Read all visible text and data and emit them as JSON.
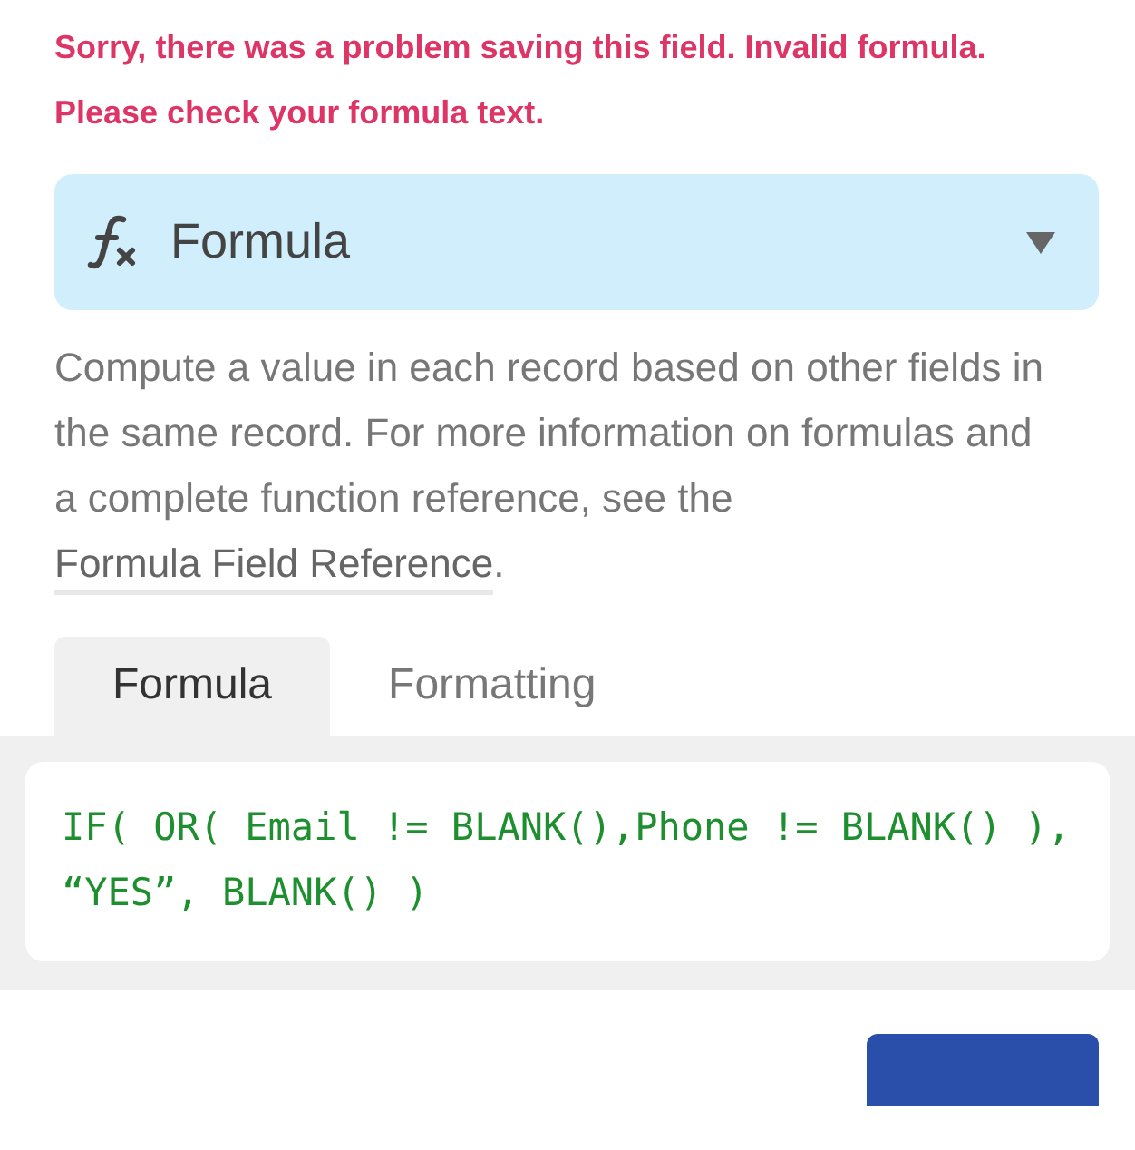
{
  "error_message": "Sorry, there was a problem saving this field. Invalid formula. Please check your formula text.",
  "field_type": {
    "label": "Formula",
    "expanded": false
  },
  "description": {
    "text": "Compute a value in each record based on other fields in the same record. For more information on formulas and a complete function reference, see the ",
    "link": "Formula Field Reference",
    "after": "."
  },
  "tabs": [
    {
      "label": "Formula",
      "selected": true
    },
    {
      "label": "Formatting",
      "selected": false
    }
  ],
  "formula": {
    "value": "IF( OR( Email != BLANK(),Phone != BLANK() ), “YES”, BLANK() )"
  }
}
